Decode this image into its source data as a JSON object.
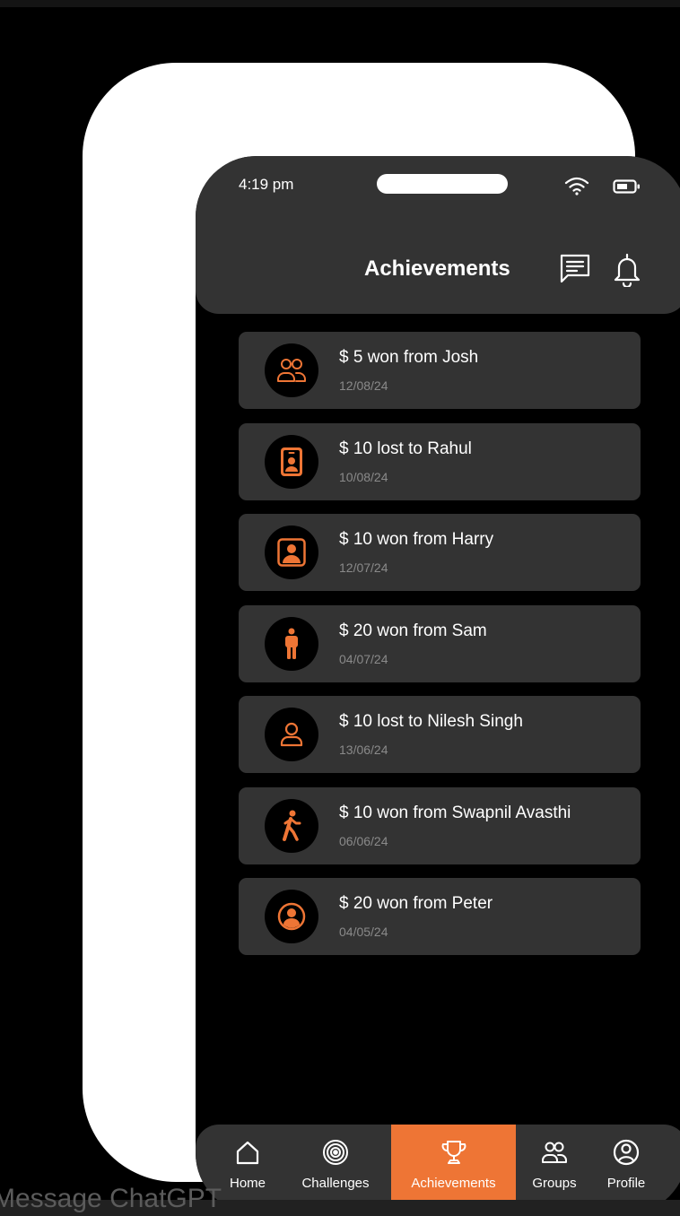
{
  "status_bar": {
    "time": "4:19 pm"
  },
  "header": {
    "title": "Achievements"
  },
  "achievements": [
    {
      "title": "$ 5 won from Josh",
      "date": "12/08/24",
      "icon": "users-icon"
    },
    {
      "title": "$ 10 lost to Rahul",
      "date": "10/08/24",
      "icon": "id-badge-icon"
    },
    {
      "title": "$ 10 won from Harry",
      "date": "12/07/24",
      "icon": "portrait-icon"
    },
    {
      "title": "$ 20 won from Sam",
      "date": "04/07/24",
      "icon": "standing-person-icon"
    },
    {
      "title": "$ 10 lost to Nilesh Singh",
      "date": "13/06/24",
      "icon": "user-icon"
    },
    {
      "title": "$ 10 won from Swapnil Avasthi",
      "date": "06/06/24",
      "icon": "walking-person-icon"
    },
    {
      "title": "$ 20 won from Peter",
      "date": "04/05/24",
      "icon": "user-circle-icon"
    }
  ],
  "nav": [
    {
      "label": "Home",
      "icon": "home-icon",
      "active": false
    },
    {
      "label": "Challenges",
      "icon": "target-icon",
      "active": false
    },
    {
      "label": "Achievements",
      "icon": "trophy-icon",
      "active": true
    },
    {
      "label": "Groups",
      "icon": "groups-icon",
      "active": false
    },
    {
      "label": "Profile",
      "icon": "profile-icon",
      "active": false
    }
  ],
  "background_text": "Message ChatGPT",
  "colors": {
    "accent": "#ee7535",
    "card": "#333333",
    "background": "#000000"
  }
}
